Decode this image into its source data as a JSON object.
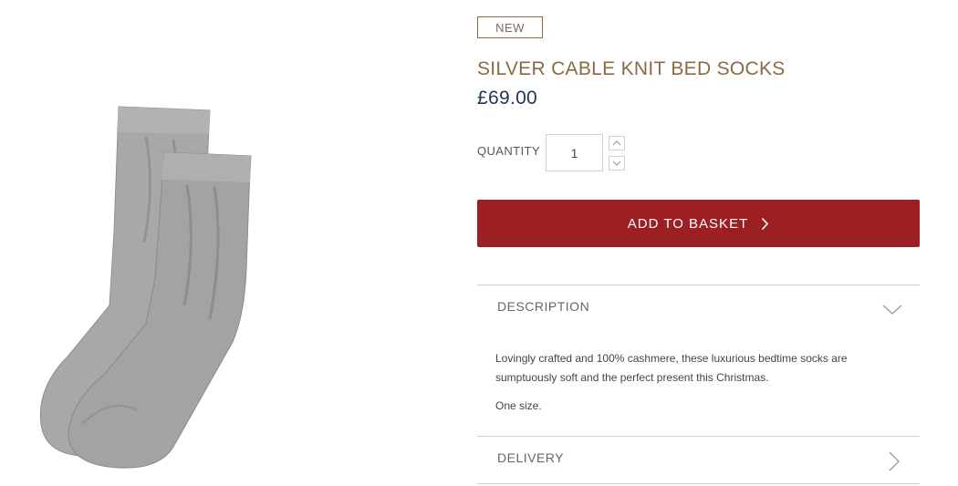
{
  "product": {
    "badge": "NEW",
    "title": "SILVER CABLE KNIT BED SOCKS",
    "price": "£69.00",
    "image_icon": "grey-cable-knit-socks-image"
  },
  "quantity": {
    "label": "QUANTITY",
    "value": "1",
    "increment_icon": "chevron-up-icon",
    "decrement_icon": "chevron-down-icon"
  },
  "basket": {
    "label": "ADD TO BASKET",
    "icon": "chevron-right-icon"
  },
  "accordion": {
    "description": {
      "title": "DESCRIPTION",
      "icon": "chevron-down-icon",
      "paragraphs": [
        "Lovingly crafted and 100% cashmere, these luxurious bedtime socks are sumptuously soft and the perfect present this Christmas.",
        "One size."
      ]
    },
    "delivery": {
      "title": "DELIVERY",
      "icon": "chevron-right-icon"
    }
  },
  "colors": {
    "accent_gold": "#8b6a43",
    "price_navy": "#1f3559",
    "basket_red": "#9b1f23",
    "sock_grey": "#a3a3a3"
  }
}
